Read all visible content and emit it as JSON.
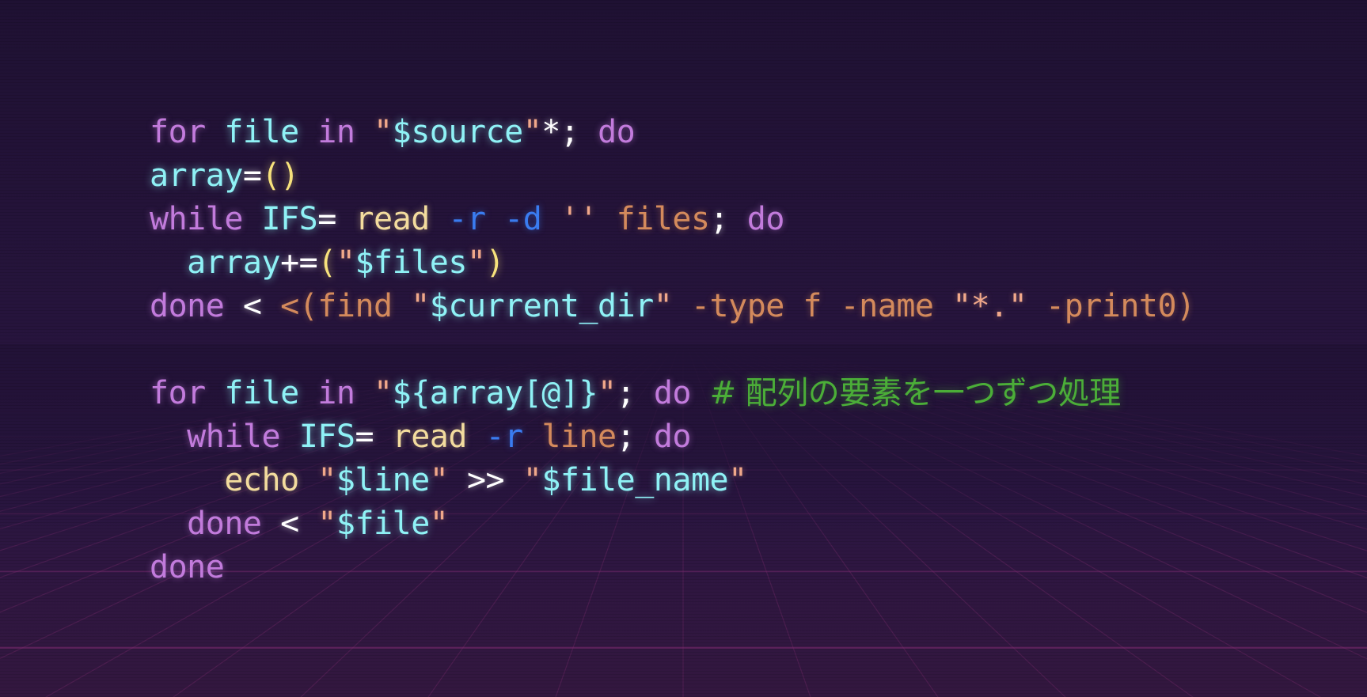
{
  "code": {
    "lines": [
      {
        "tokens": [
          {
            "text": "for",
            "cls": "c-kw"
          },
          {
            "text": " ",
            "cls": ""
          },
          {
            "text": "file",
            "cls": "c-cyan"
          },
          {
            "text": " ",
            "cls": ""
          },
          {
            "text": "in",
            "cls": "c-kw"
          },
          {
            "text": " ",
            "cls": ""
          },
          {
            "text": "\"",
            "cls": "c-str"
          },
          {
            "text": "$source",
            "cls": "c-cyan"
          },
          {
            "text": "\"",
            "cls": "c-str"
          },
          {
            "text": "*;",
            "cls": "c-white"
          },
          {
            "text": " ",
            "cls": ""
          },
          {
            "text": "do",
            "cls": "c-kw"
          }
        ]
      },
      {
        "tokens": [
          {
            "text": "array",
            "cls": "c-cyan"
          },
          {
            "text": "=",
            "cls": "c-white"
          },
          {
            "text": "()",
            "cls": "c-yellow"
          }
        ]
      },
      {
        "tokens": [
          {
            "text": "while",
            "cls": "c-kw"
          },
          {
            "text": " ",
            "cls": ""
          },
          {
            "text": "IFS",
            "cls": "c-cyan"
          },
          {
            "text": "=",
            "cls": "c-white"
          },
          {
            "text": " ",
            "cls": ""
          },
          {
            "text": "read",
            "cls": "c-cmd"
          },
          {
            "text": " ",
            "cls": ""
          },
          {
            "text": "-r",
            "cls": "c-blue"
          },
          {
            "text": " ",
            "cls": ""
          },
          {
            "text": "-d",
            "cls": "c-blue"
          },
          {
            "text": " ",
            "cls": ""
          },
          {
            "text": "''",
            "cls": "c-str"
          },
          {
            "text": " ",
            "cls": ""
          },
          {
            "text": "files",
            "cls": "c-orange"
          },
          {
            "text": ";",
            "cls": "c-white"
          },
          {
            "text": " ",
            "cls": ""
          },
          {
            "text": "do",
            "cls": "c-kw"
          }
        ]
      },
      {
        "tokens": [
          {
            "text": "  ",
            "cls": ""
          },
          {
            "text": "array",
            "cls": "c-cyan"
          },
          {
            "text": "+=",
            "cls": "c-white"
          },
          {
            "text": "(",
            "cls": "c-yellow"
          },
          {
            "text": "\"",
            "cls": "c-str"
          },
          {
            "text": "$files",
            "cls": "c-cyan"
          },
          {
            "text": "\"",
            "cls": "c-str"
          },
          {
            "text": ")",
            "cls": "c-yellow"
          }
        ]
      },
      {
        "tokens": [
          {
            "text": "done",
            "cls": "c-kw"
          },
          {
            "text": " ",
            "cls": ""
          },
          {
            "text": "<",
            "cls": "c-white"
          },
          {
            "text": " ",
            "cls": ""
          },
          {
            "text": "<(find ",
            "cls": "c-orange"
          },
          {
            "text": "\"",
            "cls": "c-str"
          },
          {
            "text": "$current_dir",
            "cls": "c-cyan"
          },
          {
            "text": "\"",
            "cls": "c-str"
          },
          {
            "text": " -type f -name ",
            "cls": "c-orange"
          },
          {
            "text": "\"*.\"",
            "cls": "c-str"
          },
          {
            "text": " -print0)",
            "cls": "c-orange"
          }
        ]
      },
      {
        "tokens": []
      },
      {
        "tokens": [
          {
            "text": "for",
            "cls": "c-kw"
          },
          {
            "text": " ",
            "cls": ""
          },
          {
            "text": "file",
            "cls": "c-cyan"
          },
          {
            "text": " ",
            "cls": ""
          },
          {
            "text": "in",
            "cls": "c-kw"
          },
          {
            "text": " ",
            "cls": ""
          },
          {
            "text": "\"",
            "cls": "c-str"
          },
          {
            "text": "${array[@]}",
            "cls": "c-cyan"
          },
          {
            "text": "\"",
            "cls": "c-str"
          },
          {
            "text": ";",
            "cls": "c-white"
          },
          {
            "text": " ",
            "cls": ""
          },
          {
            "text": "do",
            "cls": "c-kw"
          },
          {
            "text": " ",
            "cls": ""
          },
          {
            "text": "# 配列の要素を一つずつ処理",
            "cls": "c-green c-cmt"
          }
        ]
      },
      {
        "tokens": [
          {
            "text": "  ",
            "cls": ""
          },
          {
            "text": "while",
            "cls": "c-kw"
          },
          {
            "text": " ",
            "cls": ""
          },
          {
            "text": "IFS",
            "cls": "c-cyan"
          },
          {
            "text": "=",
            "cls": "c-white"
          },
          {
            "text": " ",
            "cls": ""
          },
          {
            "text": "read",
            "cls": "c-cmd"
          },
          {
            "text": " ",
            "cls": ""
          },
          {
            "text": "-r",
            "cls": "c-blue"
          },
          {
            "text": " ",
            "cls": ""
          },
          {
            "text": "line",
            "cls": "c-orange"
          },
          {
            "text": ";",
            "cls": "c-white"
          },
          {
            "text": " ",
            "cls": ""
          },
          {
            "text": "do",
            "cls": "c-kw"
          }
        ]
      },
      {
        "tokens": [
          {
            "text": "    ",
            "cls": ""
          },
          {
            "text": "echo",
            "cls": "c-cmd"
          },
          {
            "text": " ",
            "cls": ""
          },
          {
            "text": "\"",
            "cls": "c-str"
          },
          {
            "text": "$line",
            "cls": "c-cyan"
          },
          {
            "text": "\"",
            "cls": "c-str"
          },
          {
            "text": " ",
            "cls": ""
          },
          {
            "text": ">>",
            "cls": "c-white"
          },
          {
            "text": " ",
            "cls": ""
          },
          {
            "text": "\"",
            "cls": "c-str"
          },
          {
            "text": "$file_name",
            "cls": "c-cyan"
          },
          {
            "text": "\"",
            "cls": "c-str"
          }
        ]
      },
      {
        "tokens": [
          {
            "text": "  ",
            "cls": ""
          },
          {
            "text": "done",
            "cls": "c-kw"
          },
          {
            "text": " ",
            "cls": ""
          },
          {
            "text": "<",
            "cls": "c-white"
          },
          {
            "text": " ",
            "cls": ""
          },
          {
            "text": "\"",
            "cls": "c-str"
          },
          {
            "text": "$file",
            "cls": "c-cyan"
          },
          {
            "text": "\"",
            "cls": "c-str"
          }
        ]
      },
      {
        "tokens": [
          {
            "text": "done",
            "cls": "c-kw"
          }
        ]
      }
    ]
  },
  "colors": {
    "background": "#221237",
    "grid_line": "#7a2a6e",
    "keyword": "#c27bdc",
    "variable": "#8ff2f6",
    "string_quote": "#f0a88a",
    "operator": "#ffffff",
    "paren": "#f7e27c",
    "command": "#f3dc9e",
    "flag": "#3a7cf0",
    "argument": "#d48a5c",
    "comment": "#4bae38"
  }
}
